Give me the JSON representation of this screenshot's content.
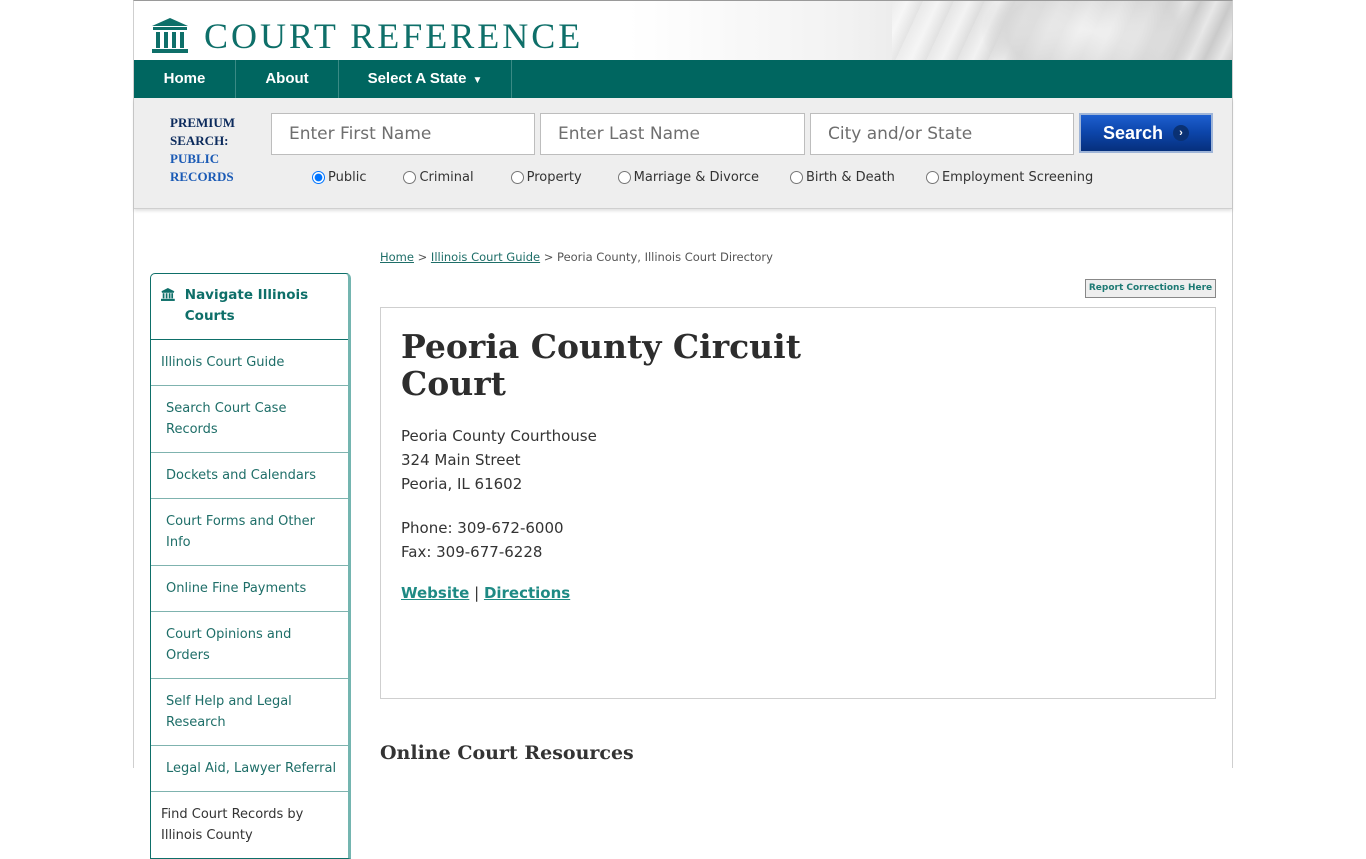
{
  "site": {
    "logo_text": "COURT REFERENCE",
    "brand_color": "#006660",
    "accent_color": "#0e6f69"
  },
  "nav": {
    "items": [
      {
        "label": "Home"
      },
      {
        "label": "About"
      },
      {
        "label": "Select A State",
        "caret": "▼"
      }
    ]
  },
  "search": {
    "premium_line1": "PREMIUM",
    "premium_line2": "SEARCH:",
    "premium_line3": "PUBLIC",
    "premium_line4": "RECORDS",
    "first_name_placeholder": "Enter First Name",
    "last_name_placeholder": "Enter Last Name",
    "city_placeholder": "City and/or State",
    "button_label": "Search",
    "button_arrow": "›",
    "options": [
      {
        "label": "Public",
        "checked": true
      },
      {
        "label": "Criminal",
        "checked": false
      },
      {
        "label": "Property",
        "checked": false
      },
      {
        "label": "Marriage & Divorce",
        "checked": false
      },
      {
        "label": "Birth & Death",
        "checked": false
      },
      {
        "label": "Employment Screening",
        "checked": false
      }
    ]
  },
  "breadcrumb": {
    "home": "Home",
    "sep": " > ",
    "guide": "Illinois Court Guide",
    "current": "Peoria County, Illinois Court Directory"
  },
  "report_button": "Report Corrections Here",
  "sidebar": {
    "title": "Navigate Illinois Courts",
    "items": [
      {
        "label": "Illinois Court Guide"
      },
      {
        "label": "Search Court Case Records"
      },
      {
        "label": "Dockets and Calendars"
      },
      {
        "label": "Court Forms and Other Info"
      },
      {
        "label": "Online Fine Payments"
      },
      {
        "label": "Court Opinions and Orders"
      },
      {
        "label": "Self Help and Legal Research"
      },
      {
        "label": "Legal Aid, Lawyer Referral"
      },
      {
        "label": "Find Court Records by Illinois County"
      }
    ]
  },
  "court": {
    "name": "Peoria County Circuit Court",
    "address_line1": "Peoria County Courthouse",
    "address_line2": "324 Main Street",
    "address_line3": "Peoria, IL 61602",
    "phone": "Phone: 309-672-6000",
    "fax": "Fax: 309-677-6228",
    "website_label": "Website",
    "link_sep": " | ",
    "directions_label": "Directions"
  },
  "sections": {
    "online_resources": "Online Court Resources"
  }
}
